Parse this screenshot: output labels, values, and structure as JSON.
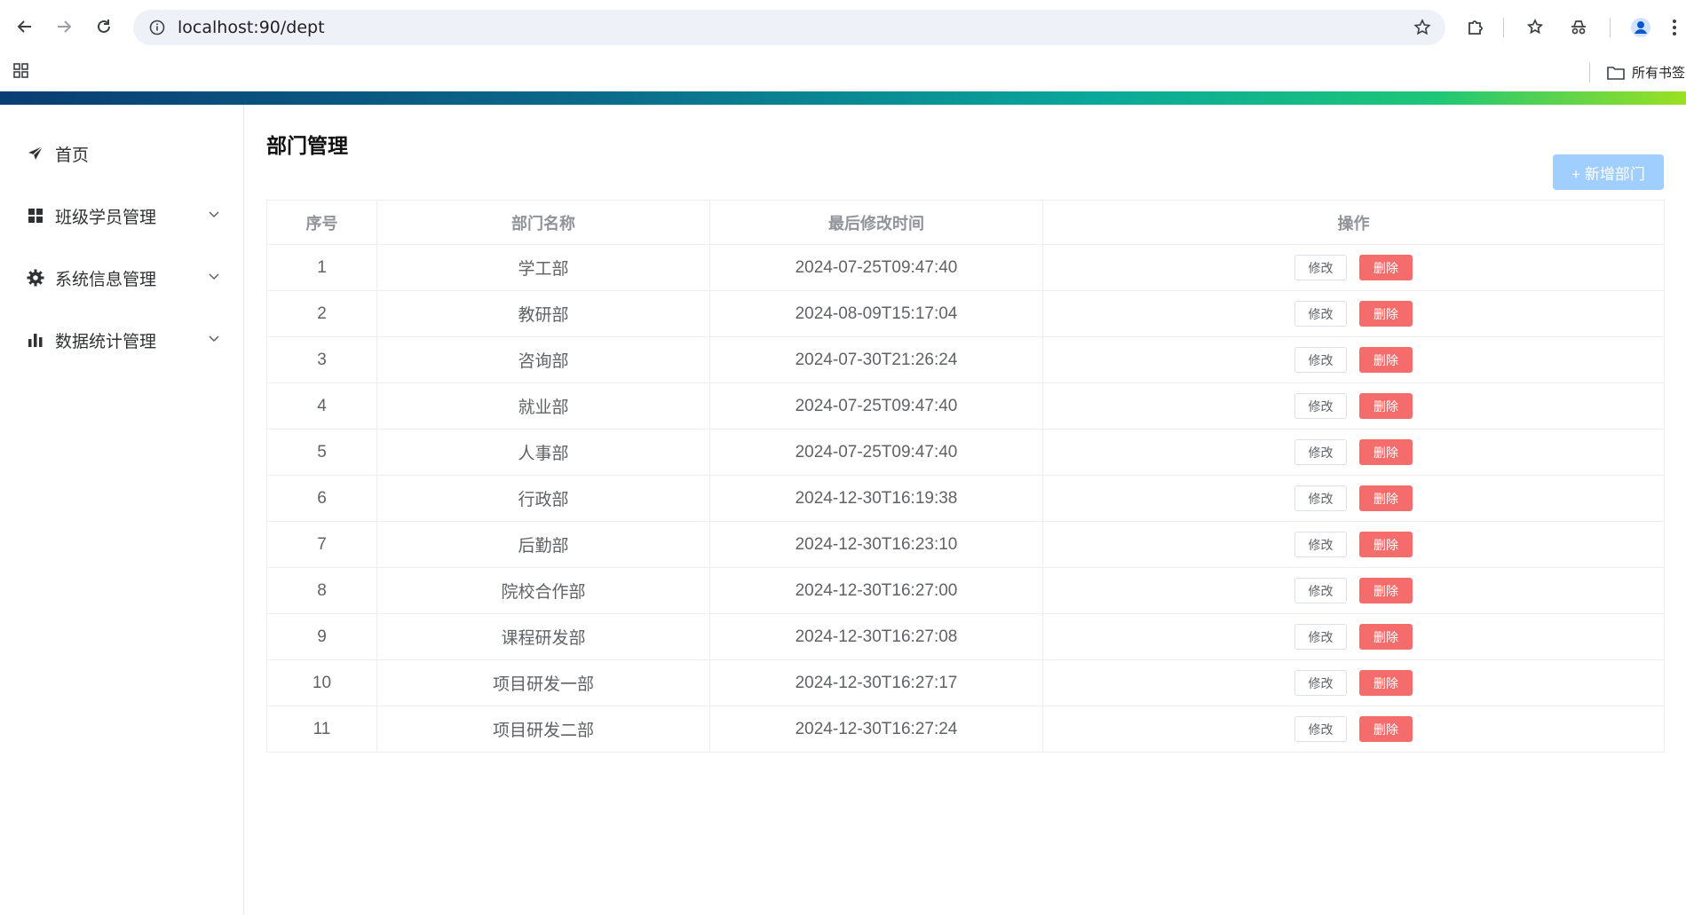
{
  "browser": {
    "url": "localhost:90/dept",
    "all_bookmarks": "所有书签"
  },
  "sidebar": {
    "items": [
      {
        "label": "首页",
        "icon": "paper-plane-icon"
      },
      {
        "label": "班级学员管理",
        "icon": "grid-icon"
      },
      {
        "label": "系统信息管理",
        "icon": "gear-icon"
      },
      {
        "label": "数据统计管理",
        "icon": "bar-chart-icon"
      }
    ]
  },
  "main": {
    "title": "部门管理",
    "add_button": "+ 新增部门",
    "table": {
      "headers": [
        "序号",
        "部门名称",
        "最后修改时间",
        "操作"
      ],
      "edit_label": "修改",
      "delete_label": "删除",
      "rows": [
        {
          "id": "1",
          "name": "学工部",
          "time": "2024-07-25T09:47:40"
        },
        {
          "id": "2",
          "name": "教研部",
          "time": "2024-08-09T15:17:04"
        },
        {
          "id": "3",
          "name": "咨询部",
          "time": "2024-07-30T21:26:24"
        },
        {
          "id": "4",
          "name": "就业部",
          "time": "2024-07-25T09:47:40"
        },
        {
          "id": "5",
          "name": "人事部",
          "time": "2024-07-25T09:47:40"
        },
        {
          "id": "6",
          "name": "行政部",
          "time": "2024-12-30T16:19:38"
        },
        {
          "id": "7",
          "name": "后勤部",
          "time": "2024-12-30T16:23:10"
        },
        {
          "id": "8",
          "name": "院校合作部",
          "time": "2024-12-30T16:27:00"
        },
        {
          "id": "9",
          "name": "课程研发部",
          "time": "2024-12-30T16:27:08"
        },
        {
          "id": "10",
          "name": "项目研发一部",
          "time": "2024-12-30T16:27:17"
        },
        {
          "id": "11",
          "name": "项目研发二部",
          "time": "2024-12-30T16:27:24"
        }
      ]
    }
  },
  "colors": {
    "primary_light": "#a0cfff",
    "danger": "#f56c6c"
  }
}
